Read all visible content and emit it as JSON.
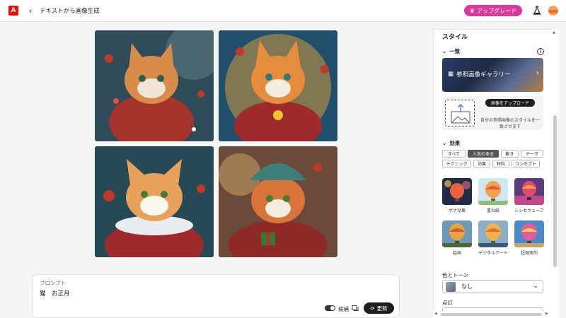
{
  "header": {
    "app_logo": "A",
    "back_icon": "chevron-left-icon",
    "title": "テキストから画像生成",
    "upgrade_label": "アップグレード",
    "upgrade_color": "#d93a9d"
  },
  "results": {
    "images": [
      {
        "alt": "cat-1"
      },
      {
        "alt": "cat-2"
      },
      {
        "alt": "cat-3"
      },
      {
        "alt": "cat-4"
      }
    ]
  },
  "prompt": {
    "label": "プロンプト",
    "value": "猫　お正月",
    "candidate_label": "候補",
    "update_label": "更新"
  },
  "panel": {
    "style_title": "スタイル",
    "match_title": "一致",
    "gallery_label": "参照画像ギャラリー",
    "upload_label": "画像をアップロード",
    "upload_desc": "自分の参照画像のスタイルを一致させます",
    "effects_title": "効果",
    "chips": [
      {
        "label": "すべて",
        "selected": false
      },
      {
        "label": "人気のある",
        "selected": true
      },
      {
        "label": "動き",
        "selected": false
      },
      {
        "label": "テーマ",
        "selected": false
      },
      {
        "label": "テクニック",
        "selected": false
      },
      {
        "label": "効果",
        "selected": false
      },
      {
        "label": "材料",
        "selected": false
      },
      {
        "label": "コンセプト",
        "selected": false
      }
    ],
    "effects": [
      {
        "label": "ボケ効果"
      },
      {
        "label": "重ね紙"
      },
      {
        "label": "シンセウェーブ"
      },
      {
        "label": "絵画"
      },
      {
        "label": "デジタルアート"
      },
      {
        "label": "超現実的"
      }
    ],
    "color_tone_label": "色とトーン",
    "color_tone_value": "なし",
    "lighting_label": "点灯"
  }
}
